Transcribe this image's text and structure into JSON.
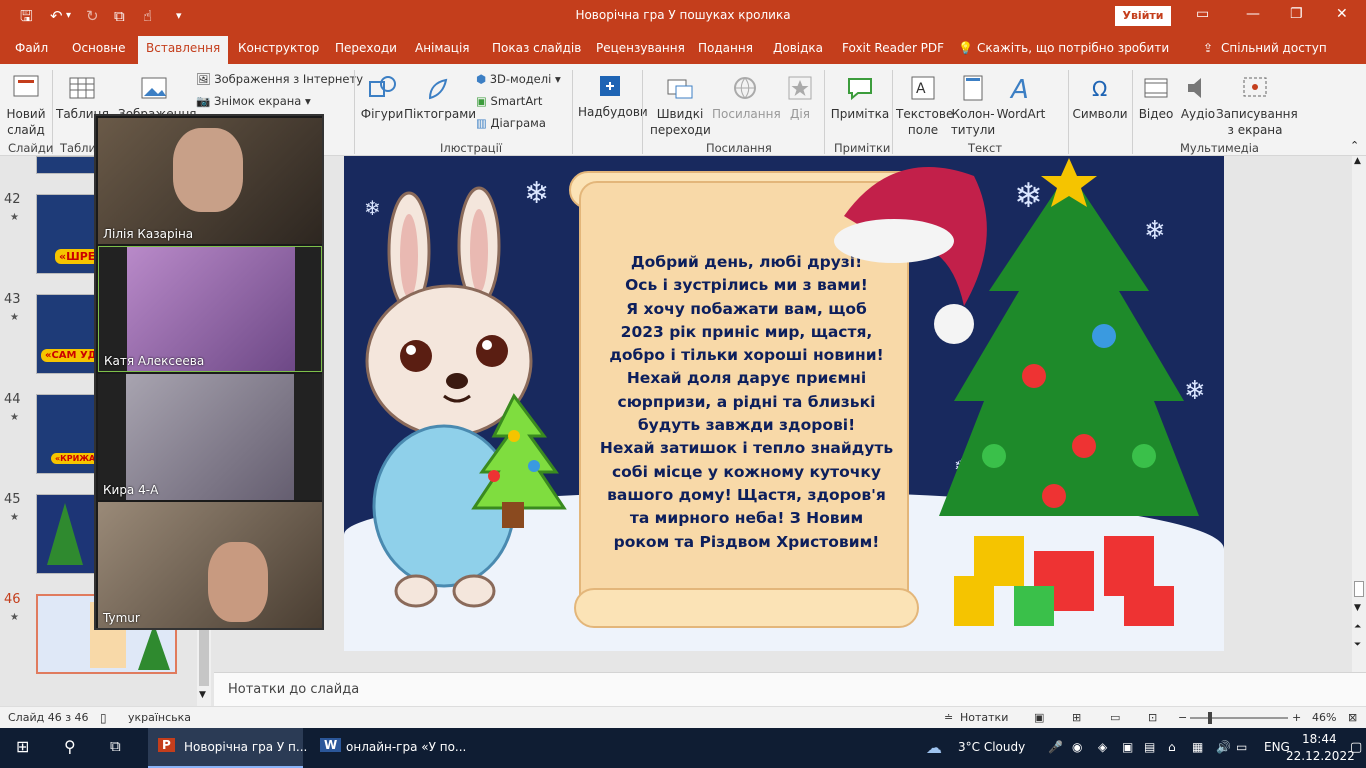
{
  "window": {
    "title": "Новорічна гра У пошуках кролика",
    "signin_label": "Увійти"
  },
  "quick_access": [
    "save-icon",
    "undo-icon",
    "redo-icon",
    "present-icon",
    "touch-icon",
    "customize-icon"
  ],
  "tabs": {
    "items": [
      "Файл",
      "Основне",
      "Вставлення",
      "Конструктор",
      "Переходи",
      "Анімація",
      "Показ слайдів",
      "Рецензування",
      "Подання",
      "Довідка",
      "Foxit Reader PDF"
    ],
    "active": "Вставлення",
    "tellme": "Скажіть, що потрібно зробити",
    "share": "Спільний доступ"
  },
  "ribbon": {
    "new_slide": "Новий слайд",
    "table": "Таблиця",
    "images": "Зображення",
    "online_images": "Зображення з Інтернету",
    "screenshot": "Знімок екрана",
    "shapes": "Фігури",
    "pictograms": "Піктограми",
    "models3d": "3D-моделі",
    "smartart": "SmartArt",
    "chart": "Діаграма",
    "addins": "Надбудови",
    "quick_links": "Швидкі переходи",
    "link": "Посилання",
    "action": "Дія",
    "comment": "Примітка",
    "textbox": "Текстове поле",
    "header_footer": "Колон-титули",
    "wordart": "WordArt",
    "symbols": "Символи",
    "video": "Відео",
    "audio": "Аудіо",
    "screen_record": "Записування з екрана",
    "groups": {
      "slides": "Слайди",
      "tables": "Таблиці",
      "illustrations": "Ілюстрації",
      "links": "Посилання",
      "comments": "Примітки",
      "text": "Текст",
      "multimedia": "Мультимедіа"
    }
  },
  "thumbnails": [
    {
      "num": "42",
      "star": "★",
      "caption": "«ШРЕ"
    },
    {
      "num": "43",
      "star": "★",
      "caption": "«САМ УД"
    },
    {
      "num": "44",
      "star": "★",
      "caption": "«КРИЖАНЕ"
    },
    {
      "num": "45",
      "star": "★",
      "caption": ""
    },
    {
      "num": "46",
      "star": "★",
      "caption": ""
    }
  ],
  "video_call": {
    "participants": [
      "Лілія Казаріна",
      "Катя Алексеева",
      "Кира 4-А",
      "Tymur"
    ]
  },
  "slide": {
    "greeting": [
      "Добрий день, любі друзі!",
      "Ось і зустрілись ми з вами!",
      "Я хочу побажати вам, щоб",
      "2023 рік приніс мир, щастя,",
      "добро і тільки хороші новини!",
      "Нехай доля дарує приємні",
      "сюрпризи, а рідні та близькі",
      "будуть завжди здорові!",
      "Нехай затишок і тепло знайдуть",
      "собі місце у кожному куточку",
      "вашого дому! Щастя, здоров'я",
      "та мирного неба! З Новим",
      "роком та Різдвом Христовим!"
    ]
  },
  "notes_placeholder": "Нотатки до слайда",
  "status": {
    "slide_info": "Слайд 46 з 46",
    "language": "українська",
    "notes_btn": "Нотатки",
    "zoom": "46%"
  },
  "taskbar": {
    "app1": "Новорічна гра У п...",
    "app2": "онлайн-гра «У по...",
    "weather": "3°C  Cloudy",
    "lang": "ENG",
    "time": "18:44",
    "date": "22.12.2022"
  },
  "colors": {
    "accent": "#c43e1c",
    "slide_bg": "#18295e",
    "scroll": "#f8d9a8",
    "text_dark": "#0d1f5c"
  }
}
